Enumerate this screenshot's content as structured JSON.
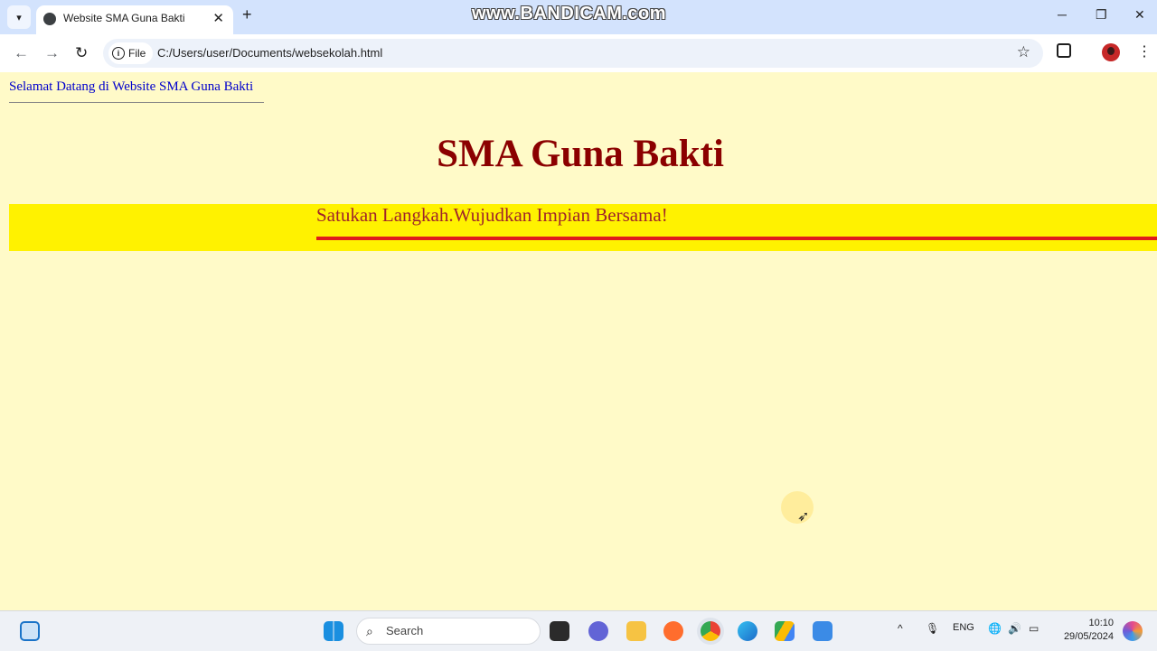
{
  "browser": {
    "tab_title": "Website SMA Guna Bakti",
    "site_chip": "File",
    "url": "C:/Users/user/Documents/websekolah.html"
  },
  "watermark": "www.BANDICAM.com",
  "page": {
    "welcome": "Selamat Datang di Website SMA Guna Bakti",
    "school_title": "SMA Guna Bakti",
    "motto": "Satukan Langkah.Wujudkan Impian Bersama!"
  },
  "taskbar": {
    "search_placeholder": "Search",
    "language": "ENG",
    "time": "10:10",
    "date": "29/05/2024"
  },
  "colors": {
    "page_bg": "#fffac8",
    "banner": "#fff200",
    "title": "#8b0000",
    "motto": "#a0252a",
    "motto_underline": "#e01b1b",
    "welcome_link": "#0000cc"
  }
}
